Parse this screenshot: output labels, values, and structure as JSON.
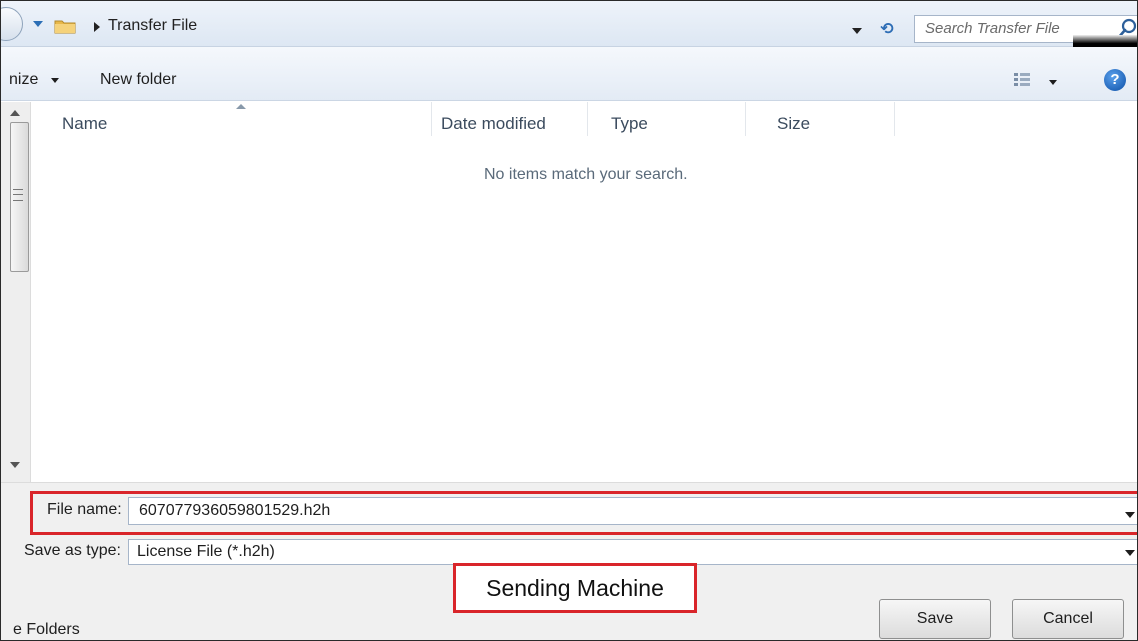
{
  "address_bar": {
    "breadcrumb": "Transfer File",
    "search_placeholder": "Search Transfer File"
  },
  "toolbar": {
    "organize_label": "nize",
    "new_folder_label": "New folder"
  },
  "file_list": {
    "columns": [
      "Name",
      "Date modified",
      "Type",
      "Size"
    ],
    "empty_message": "No items match your search."
  },
  "save_panel": {
    "file_name_label": "File name:",
    "file_name_value": "607077936059801529.h2h",
    "save_type_label": "Save as type:",
    "save_type_value": "License File (*.h2h)",
    "hide_folders_label": "e Folders",
    "save_button": "Save",
    "cancel_button": "Cancel"
  },
  "annotation": {
    "text": "Sending Machine",
    "border_color": "#d9252a"
  },
  "icons": {
    "back": "back-arrow-icon",
    "folder": "folder-icon",
    "refresh": "refresh-icon",
    "search": "search-icon",
    "views": "view-options-icon",
    "help": "help-icon"
  },
  "colors": {
    "highlight_red": "#d9252a",
    "toolbar_blue": "#e3ebf5",
    "help_blue": "#0c4fa6"
  }
}
